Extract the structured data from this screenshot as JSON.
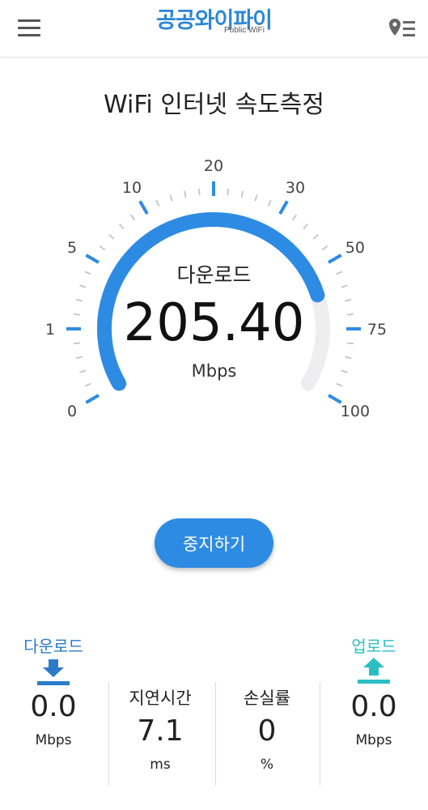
{
  "header": {
    "logo_main": "공공와이파이",
    "logo_sub": "Public WiFi"
  },
  "title": "WiFi 인터넷 속도측정",
  "gauge": {
    "label": "다운로드",
    "value": "205.40",
    "unit": "Mbps",
    "fill_fraction": 0.8,
    "ticks": [
      "0",
      "1",
      "5",
      "10",
      "20",
      "30",
      "50",
      "75",
      "100"
    ],
    "colors": {
      "fill": "#2e8be3",
      "track": "#eeeef0",
      "tick": "#2e8be3",
      "minor": "#c8c8c8"
    }
  },
  "stop_label": "중지하기",
  "stats": {
    "download": {
      "label": "다운로드",
      "value": "0.0",
      "unit": "Mbps",
      "color": "#2b7bc8"
    },
    "latency": {
      "label": "지연시간",
      "value": "7.1",
      "unit": "ms"
    },
    "loss": {
      "label": "손실률",
      "value": "0",
      "unit": "%"
    },
    "upload": {
      "label": "업로드",
      "value": "0.0",
      "unit": "Mbps",
      "color": "#2bbfc4"
    }
  }
}
